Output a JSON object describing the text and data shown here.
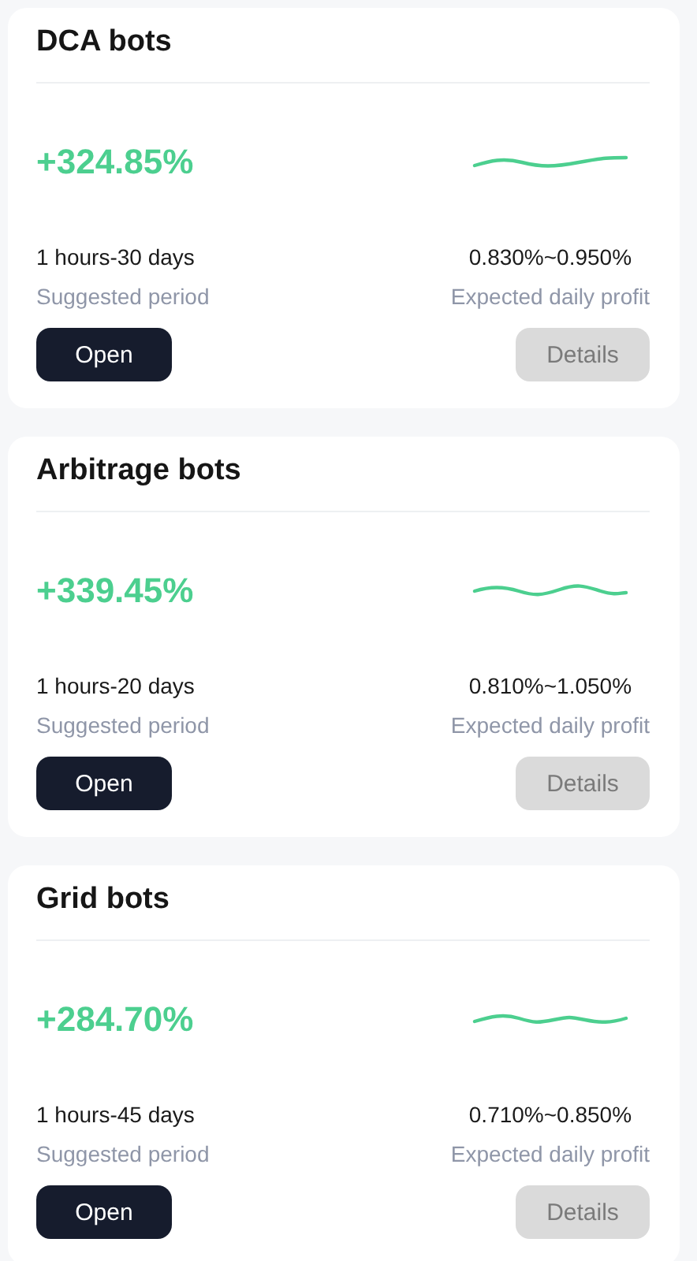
{
  "cards": [
    {
      "title": "DCA bots",
      "return": "+324.85%",
      "period": "1 hours-30 days",
      "period_label": "Suggested period",
      "profit": "0.830%~0.950%",
      "profit_label": "Expected daily profit",
      "open_button": "Open",
      "details_button": {
        "label": "Details",
        "disabled": true
      }
    },
    {
      "title": "Arbitrage bots",
      "return": "+339.45%",
      "period": "1 hours-20 days",
      "period_label": "Suggested period",
      "profit": "0.810%~1.050%",
      "profit_label": "Expected daily profit",
      "open_button": "Open",
      "details_button": {
        "label": "Details",
        "disabled": true
      }
    },
    {
      "title": "Grid bots",
      "return": "+284.70%",
      "period": "1 hours-45 days",
      "period_label": "Suggested period",
      "profit": "0.710%~0.850%",
      "profit_label": "Expected daily profit",
      "open_button": "Open",
      "details_button": {
        "label": "Details",
        "disabled": true
      }
    }
  ]
}
